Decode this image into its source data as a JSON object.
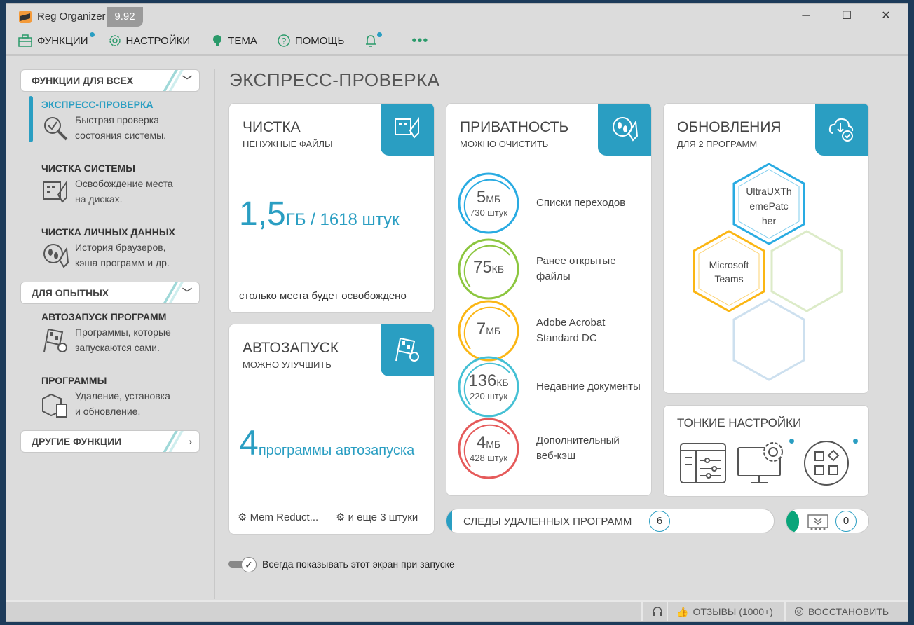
{
  "app": {
    "title": "Reg Organizer",
    "version": "9.92"
  },
  "menu": [
    {
      "label": "ФУНКЦИИ",
      "icon": "toolbox-icon"
    },
    {
      "label": "НАСТРОЙКИ",
      "icon": "gear-icon"
    },
    {
      "label": "ТЕМА",
      "icon": "bulb-icon"
    },
    {
      "label": "ПОМОЩЬ",
      "icon": "help-icon"
    }
  ],
  "sidebar": {
    "sections": [
      {
        "label": "ФУНКЦИИ ДЛЯ ВСЕХ"
      },
      {
        "label": "ДЛЯ ОПЫТНЫХ"
      },
      {
        "label": "ДРУГИЕ ФУНКЦИИ"
      }
    ],
    "items": [
      {
        "title": "ЭКСПРЕСС-ПРОВЕРКА",
        "desc1": "Быстрая проверка",
        "desc2": "состояния системы.",
        "active": true
      },
      {
        "title": "ЧИСТКА СИСТЕМЫ",
        "desc1": "Освобождение места",
        "desc2": "на дисках."
      },
      {
        "title": "ЧИСТКА ЛИЧНЫХ ДАННЫХ",
        "desc1": "История браузеров,",
        "desc2": "кэша программ и др."
      },
      {
        "title": "АВТОЗАПУСК ПРОГРАММ",
        "desc1": "Программы, которые",
        "desc2": "запускаются сами."
      },
      {
        "title": "ПРОГРАММЫ",
        "desc1": "Удаление, установка",
        "desc2": "и обновление."
      }
    ]
  },
  "main": {
    "title": "ЭКСПРЕСС-ПРОВЕРКА",
    "cleanup": {
      "title": "ЧИСТКА",
      "subtitle": "НЕНУЖНЫЕ ФАЙЛЫ",
      "value": "1,5",
      "unit": "ГБ / 1618 штук",
      "note": "столько места будет освобождено"
    },
    "autorun": {
      "title": "АВТОЗАПУСК",
      "subtitle": "МОЖНО УЛУЧШИТЬ",
      "value": "4",
      "unit": "программы автозапуска",
      "item1": "Mem Reduct...",
      "item2": "и еще 3 штуки"
    },
    "privacy": {
      "title": "ПРИВАТНОСТЬ",
      "subtitle": "МОЖНО ОЧИСТИТЬ",
      "items": [
        {
          "value": "5",
          "unit": "МБ",
          "count": "730 штук",
          "label1": "Списки переходов",
          "label2": "",
          "color": "#29abe2"
        },
        {
          "value": "75",
          "unit": "КБ",
          "count": "",
          "label1": "Ранее открытые",
          "label2": "файлы",
          "color": "#8cc63f"
        },
        {
          "value": "7",
          "unit": "МБ",
          "count": "",
          "label1": "Adobe Acrobat",
          "label2": "Standard DC",
          "color": "#fbb614"
        },
        {
          "value": "136",
          "unit": "КБ",
          "count": "220 штук",
          "label1": "Недавние документы",
          "label2": "",
          "color": "#45c0d4"
        },
        {
          "value": "4",
          "unit": "МБ",
          "count": "428 штук",
          "label1": "Дополнительный",
          "label2": "веб-кэш",
          "color": "#e55a5a"
        }
      ]
    },
    "updates": {
      "title": "ОБНОВЛЕНИЯ",
      "subtitle": "ДЛЯ 2 ПРОГРАММ",
      "apps": [
        "UltraUXTh emePatc her",
        "Microsoft Teams"
      ]
    },
    "tweaks": {
      "title": "ТОНКИЕ НАСТРОЙКИ"
    },
    "leftovers": {
      "label": "СЛЕДЫ УДАЛЕННЫХ ПРОГРАММ",
      "count": "6"
    },
    "drivers": {
      "count": "0"
    },
    "show_on_start": "Всегда показывать этот экран при запуске"
  },
  "status": {
    "reviews": "ОТЗЫВЫ (1000+)",
    "restore": "ВОССТАНОВИТЬ"
  },
  "colors": {
    "accent": "#2a9ec2",
    "green": "#0aa57a"
  }
}
